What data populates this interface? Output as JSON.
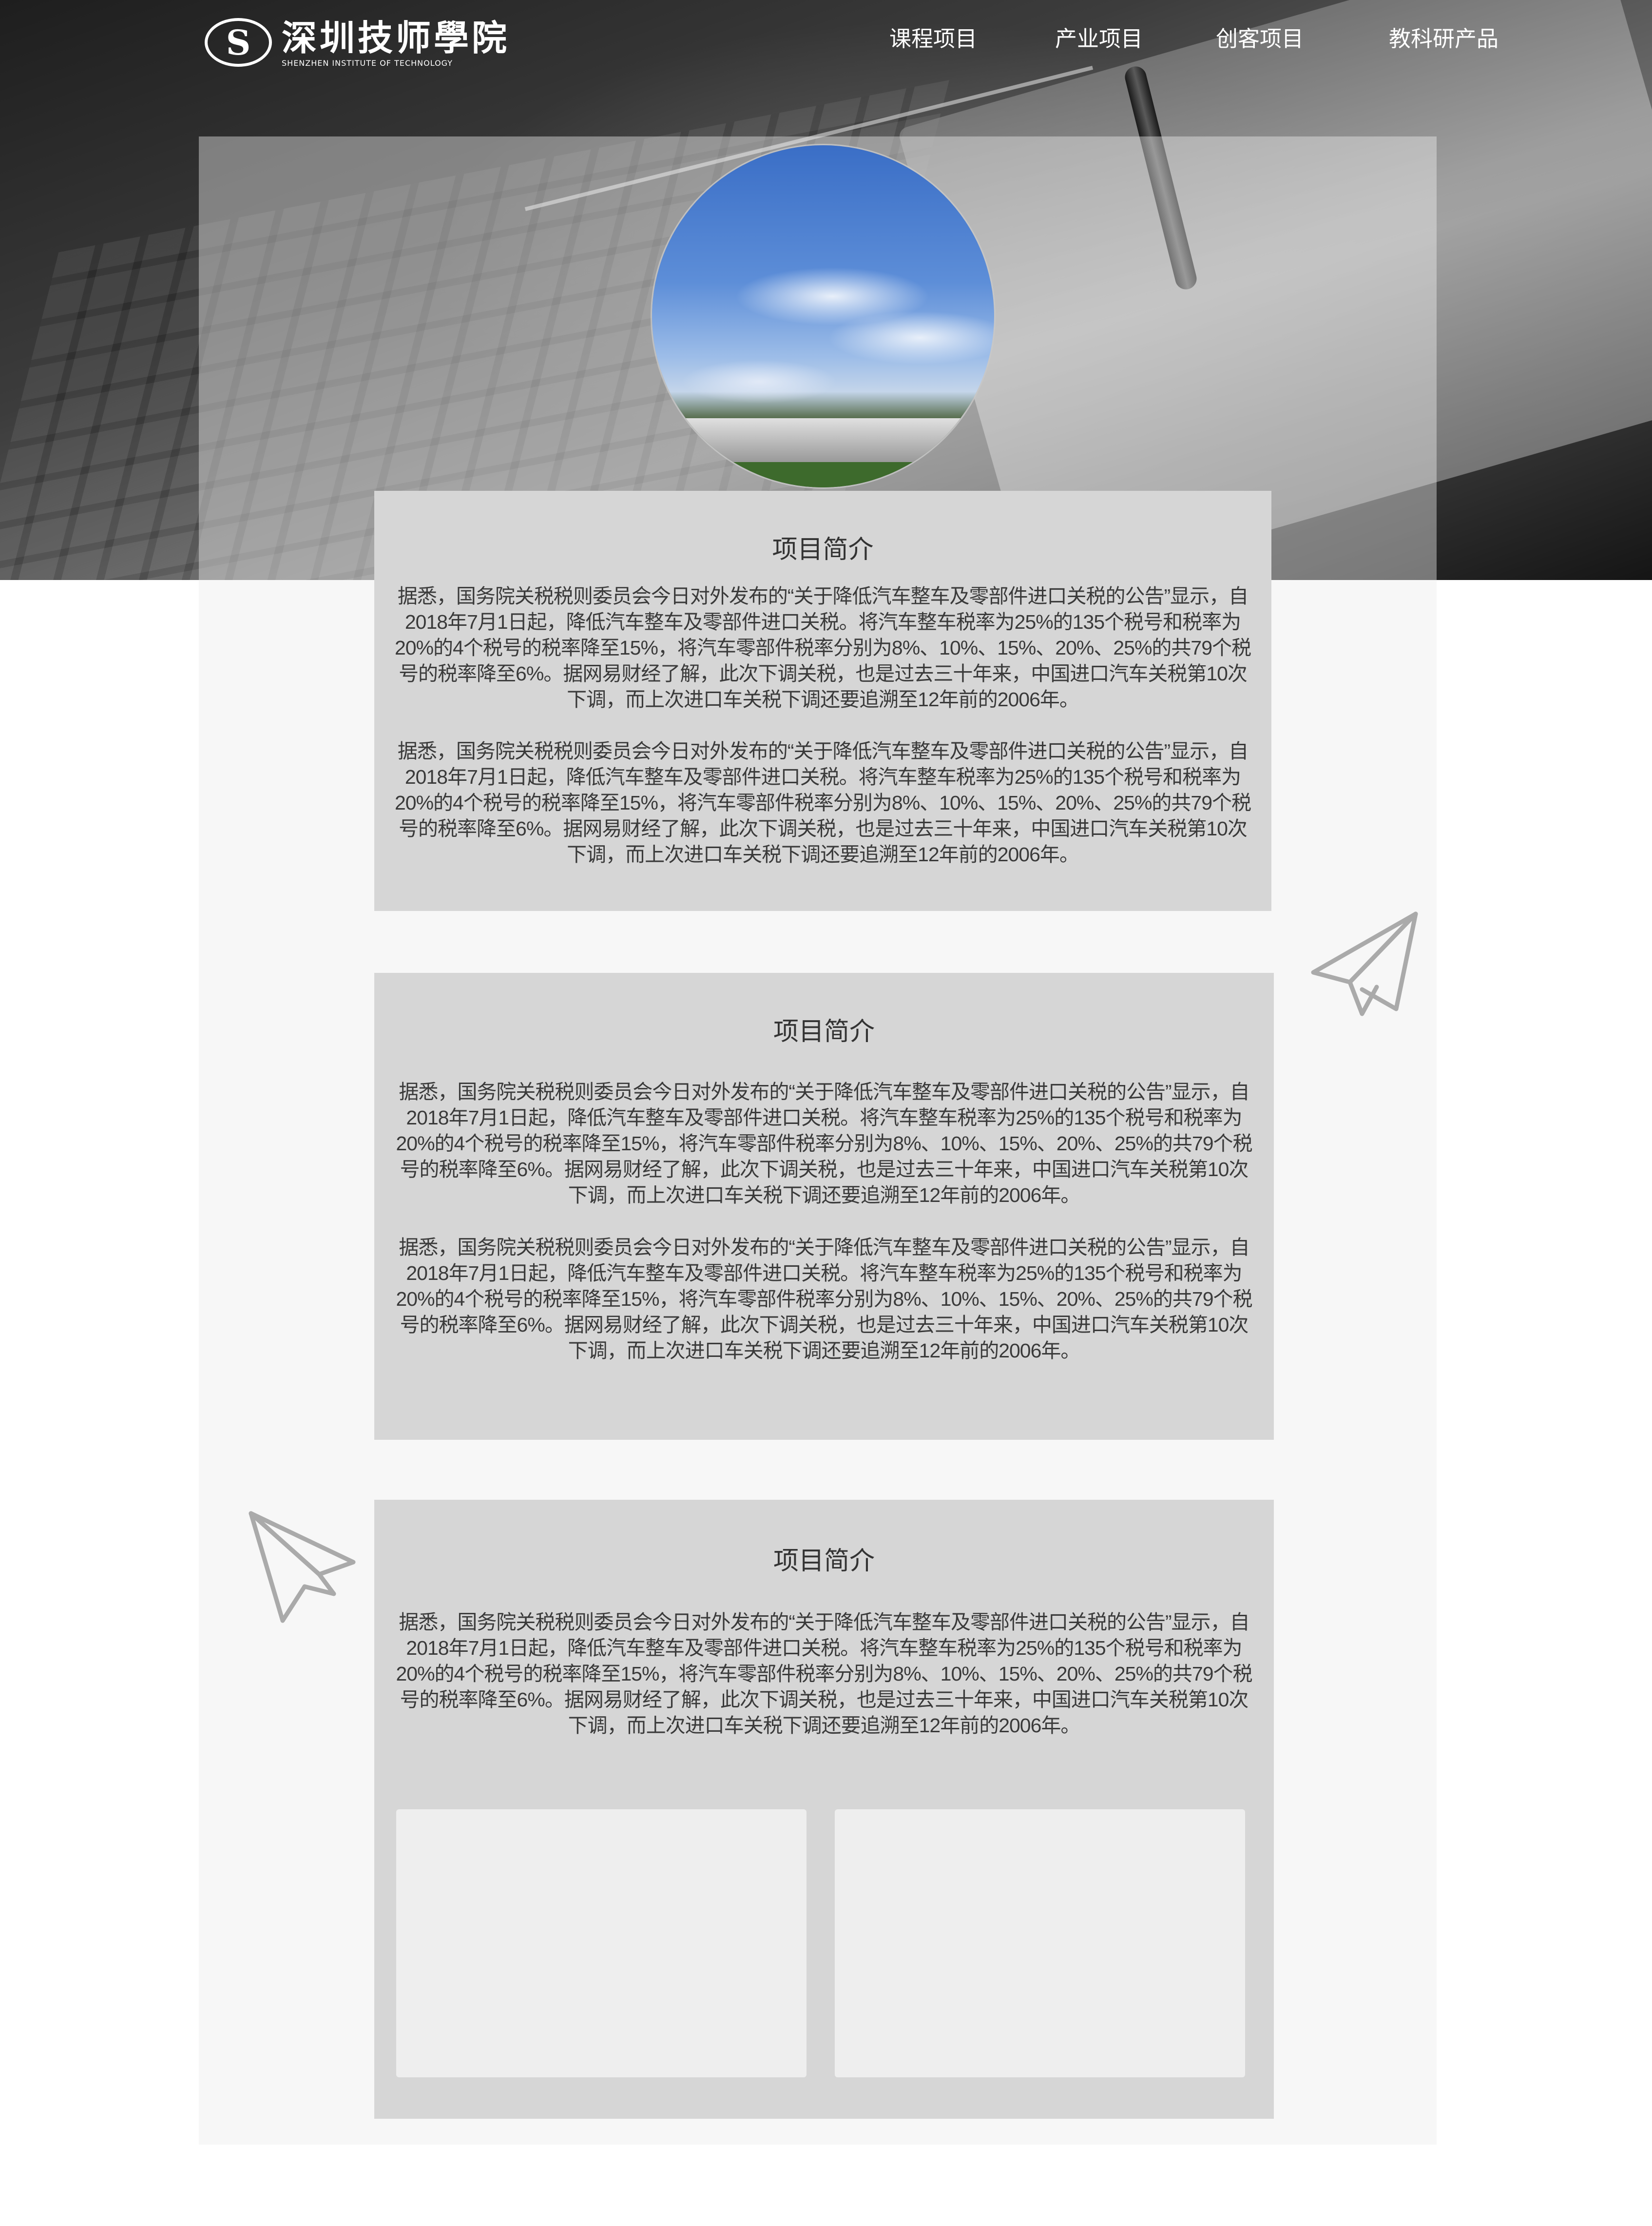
{
  "header": {
    "logo_mark": "S",
    "logo_cn": "深圳技师學院",
    "logo_en": "SHENZHEN INSTITUTE OF TECHNOLOGY",
    "nav": [
      "课程项目",
      "产业项目",
      "创客项目",
      "教科研产品"
    ]
  },
  "sections": [
    {
      "title": "项目简介",
      "paragraphs": [
        "据悉，国务院关税税则委员会今日对外发布的“关于降低汽车整车及零部件进口关税的公告”显示，自2018年7月1日起，降低汽车整车及零部件进口关税。将汽车整车税率为25%的135个税号和税率为20%的4个税号的税率降至15%，将汽车零部件税率分别为8%、10%、15%、20%、25%的共79个税号的税率降至6%。据网易财经了解，此次下调关税，也是过去三十年来，中国进口汽车关税第10次下调，而上次进口车关税下调还要追溯至12年前的2006年。",
        "据悉，国务院关税税则委员会今日对外发布的“关于降低汽车整车及零部件进口关税的公告”显示，自2018年7月1日起，降低汽车整车及零部件进口关税。将汽车整车税率为25%的135个税号和税率为20%的4个税号的税率降至15%，将汽车零部件税率分别为8%、10%、15%、20%、25%的共79个税号的税率降至6%。据网易财经了解，此次下调关税，也是过去三十年来，中国进口汽车关税第10次下调，而上次进口车关税下调还要追溯至12年前的2006年。"
      ]
    },
    {
      "title": "项目简介",
      "paragraphs": [
        "据悉，国务院关税税则委员会今日对外发布的“关于降低汽车整车及零部件进口关税的公告”显示，自2018年7月1日起，降低汽车整车及零部件进口关税。将汽车整车税率为25%的135个税号和税率为20%的4个税号的税率降至15%，将汽车零部件税率分别为8%、10%、15%、20%、25%的共79个税号的税率降至6%。据网易财经了解，此次下调关税，也是过去三十年来，中国进口汽车关税第10次下调，而上次进口车关税下调还要追溯至12年前的2006年。",
        "据悉，国务院关税税则委员会今日对外发布的“关于降低汽车整车及零部件进口关税的公告”显示，自2018年7月1日起，降低汽车整车及零部件进口关税。将汽车整车税率为25%的135个税号和税率为20%的4个税号的税率降至15%，将汽车零部件税率分别为8%、10%、15%、20%、25%的共79个税号的税率降至6%。据网易财经了解，此次下调关税，也是过去三十年来，中国进口汽车关税第10次下调，而上次进口车关税下调还要追溯至12年前的2006年。"
      ]
    },
    {
      "title": "项目简介",
      "paragraphs": [
        "据悉，国务院关税税则委员会今日对外发布的“关于降低汽车整车及零部件进口关税的公告”显示，自2018年7月1日起，降低汽车整车及零部件进口关税。将汽车整车税率为25%的135个税号和税率为20%的4个税号的税率降至15%，将汽车零部件税率分别为8%、10%、15%、20%、25%的共79个税号的税率降至6%。据网易财经了解，此次下调关税，也是过去三十年来，中国进口汽车关税第10次下调，而上次进口车关税下调还要追溯至12年前的2006年。"
      ]
    }
  ],
  "icons": {
    "logo": "school-emblem-icon",
    "decor": "paper-plane-icon"
  },
  "colors": {
    "card_bg": "#d6d6d6",
    "thumb_bg": "#eeeeee",
    "text": "#3a3a3a",
    "plane_stroke": "#aaaaaa"
  }
}
